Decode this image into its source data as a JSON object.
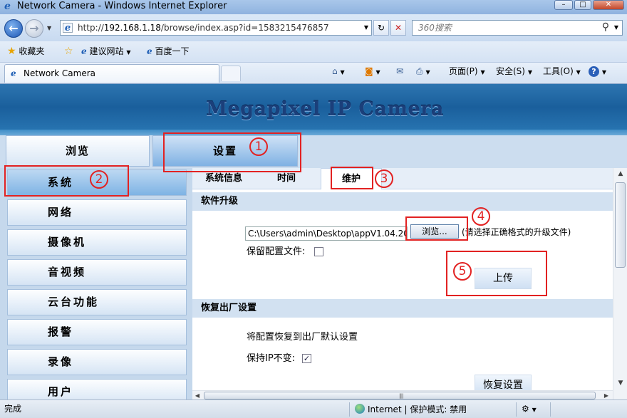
{
  "browser": {
    "window_title": "Network Camera - Windows Internet Explorer",
    "url_prefix": "http://",
    "url_host": "192.168.1.18",
    "url_path": "/browse/index.asp?id=1583215476857",
    "search_placeholder": "360搜索",
    "favorites_label": "收藏夹",
    "suggested_sites": "建议网站",
    "baidu": "百度一下",
    "tab_title": "Network Camera",
    "cmd_page": "页面(P)",
    "cmd_safety": "安全(S)",
    "cmd_tools": "工具(O)"
  },
  "page": {
    "brand": "Megapixel IP Camera",
    "top_nav": [
      "浏览",
      "设置"
    ],
    "side_nav": [
      "系统",
      "网络",
      "摄像机",
      "音视频",
      "云台功能",
      "报警",
      "录像",
      "用户"
    ],
    "sub_tabs": [
      "系统信息",
      "时间",
      "维护"
    ],
    "upgrade": {
      "header": "软件升级",
      "file_value": "C:\\Users\\admin\\Desktop\\appV1.04.20-",
      "browse_label": "浏览...",
      "hint": "(请选择正确格式的升级文件)",
      "keep_config_label": "保留配置文件:",
      "upload_label": "上传"
    },
    "restore": {
      "header": "恢复出厂设置",
      "description": "将配置恢复到出厂默认设置",
      "keep_ip_label": "保持IP不变:",
      "keep_ip_check": "✓",
      "restore_label": "恢复设置"
    }
  },
  "annotations": [
    "1",
    "2",
    "3",
    "4",
    "5"
  ],
  "annotation_color": "#e22222",
  "status": {
    "left": "完成",
    "zone": "Internet | 保护模式: 禁用"
  }
}
